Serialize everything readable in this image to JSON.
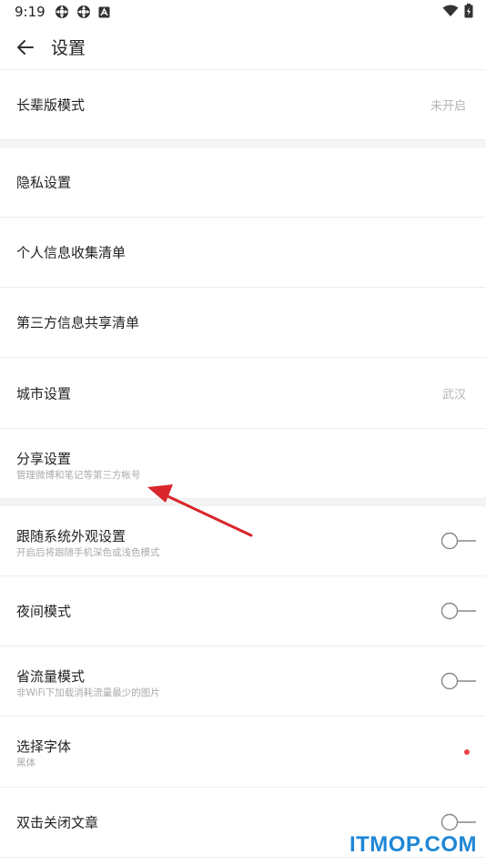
{
  "status_bar": {
    "time": "9:19",
    "left_icons": [
      "settings-gear-icon",
      "settings-gear-icon",
      "app-notification-icon"
    ],
    "right_icons": [
      "wifi-icon",
      "battery-icon"
    ]
  },
  "appbar": {
    "title": "设置",
    "back_icon": "arrow-left-icon"
  },
  "sections": [
    {
      "rows": [
        {
          "title": "长辈版模式",
          "value": "未开启"
        }
      ]
    },
    {
      "rows": [
        {
          "title": "隐私设置"
        },
        {
          "title": "个人信息收集清单"
        },
        {
          "title": "第三方信息共享清单"
        },
        {
          "title": "城市设置",
          "value": "武汉"
        },
        {
          "title": "分享设置",
          "subtitle": "管理微博和笔记等第三方帐号"
        }
      ]
    },
    {
      "rows": [
        {
          "title": "跟随系统外观设置",
          "subtitle": "开启后将跟随手机深色或浅色模式",
          "toggle": false
        },
        {
          "title": "夜间模式",
          "toggle": false
        },
        {
          "title": "省流量模式",
          "subtitle": "非WiFi下加载消耗流量最少的图片",
          "toggle": false
        },
        {
          "title": "选择字体",
          "subtitle": "黑体",
          "indicator_color": "#e8454a"
        },
        {
          "title": "双击关闭文章",
          "toggle": false
        }
      ]
    }
  ],
  "annotation": {
    "color": "#d9262c"
  },
  "watermark": "ITMOP.COM",
  "colors": {
    "accent": "#e8454a",
    "watermark": "#1f87d6"
  }
}
